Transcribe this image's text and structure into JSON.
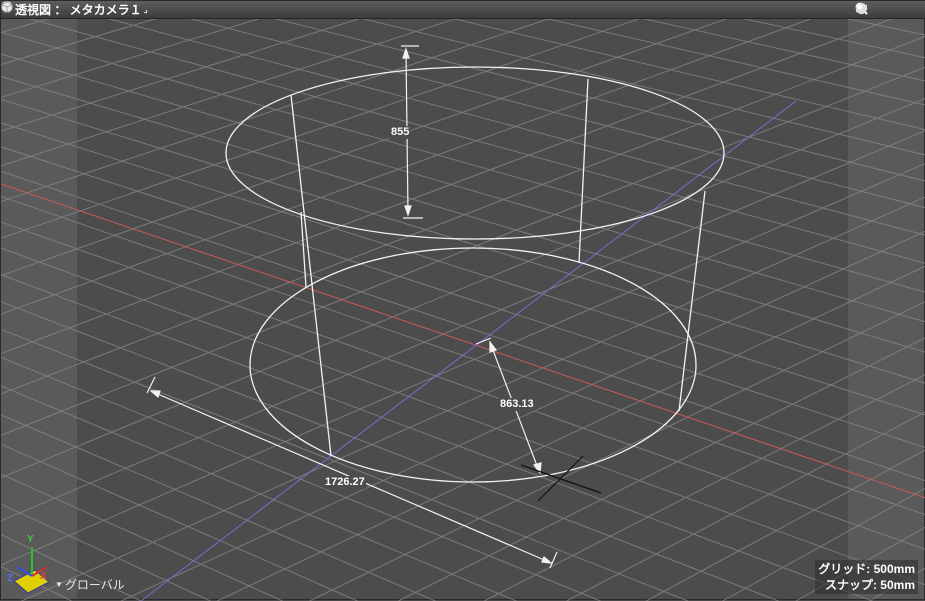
{
  "titlebar": {
    "title": "透視図 ： メタカメラ１",
    "corner_mark": "⌟",
    "left_icons": [
      "target-icon",
      "cube-icon"
    ],
    "right_icons": [
      "move-icon",
      "rotate-icon",
      "zoom-icon",
      "sphere-icon"
    ]
  },
  "dimensions": {
    "height": "855",
    "radius": "863.13",
    "diameter": "1726.27"
  },
  "axes": {
    "x": "X",
    "y": "Y",
    "z": "Z"
  },
  "coordinate_system": "グローバル",
  "status": {
    "grid": "グリッド: 500mm",
    "snap": "スナップ: 50mm"
  },
  "colors": {
    "background": "#4c4c4c",
    "grid_line": "#8a8a8a",
    "x_axis_line": "#c85a5a",
    "z_axis_line": "#7070d0",
    "wireframe": "#f2f2f2"
  }
}
